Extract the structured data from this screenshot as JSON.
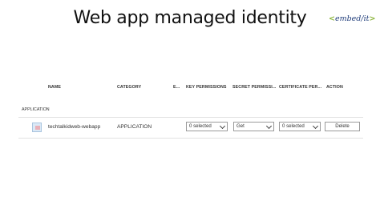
{
  "slide": {
    "title": "Web app managed identity"
  },
  "logo": {
    "open": "<",
    "text": "embed/it",
    "close": ">"
  },
  "table": {
    "headers": {
      "name": "NAME",
      "category": "CATEGORY",
      "e": "E...",
      "key": "KEY PERMISSIONS",
      "secret": "SECRET PERMISSI...",
      "cert": "CERTIFICATE PER...",
      "action": "ACTION"
    },
    "section_label": "APPLICATION",
    "rows": [
      {
        "name": "techtalkidweb-webapp",
        "category": "APPLICATION",
        "key_permissions": "0 selected",
        "secret_permissions": "Get",
        "certificate_permissions": "0 selected",
        "action": "Delete"
      }
    ]
  }
}
